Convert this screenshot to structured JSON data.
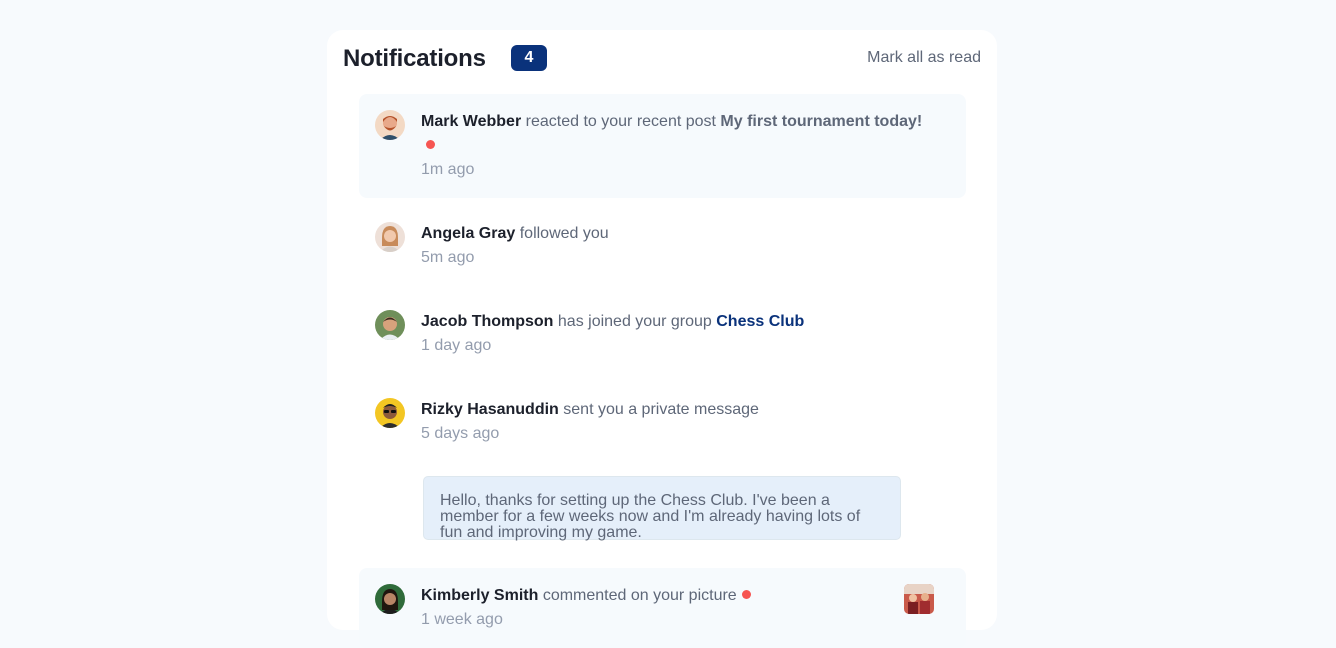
{
  "header": {
    "title": "Notifications",
    "count": "4",
    "mark_all": "Mark all as read"
  },
  "notifications": [
    {
      "name": "Mark Webber",
      "action": "reacted to your recent post",
      "target": "My first tournament today!",
      "time": "1m ago",
      "unread": true
    },
    {
      "name": "Angela Gray",
      "action": "followed you",
      "time": "5m ago",
      "unread": false
    },
    {
      "name": "Jacob Thompson",
      "action": "has joined your group",
      "target": "Chess Club",
      "time": "1 day ago",
      "unread": false
    },
    {
      "name": "Rizky Hasanuddin",
      "action": "sent you a private message",
      "time": "5 days ago",
      "message": "Hello, thanks for setting up the Chess Club. I've been a member for a few weeks now and I'm already having lots of fun and improving my game.",
      "unread": false
    },
    {
      "name": "Kimberly Smith",
      "action": "commented on your picture",
      "time": "1 week ago",
      "unread": true
    }
  ],
  "colors": {
    "accent": "#0a327b",
    "unread_dot": "#f65552",
    "unread_bg": "#f6fafd",
    "message_bg": "#e5effa"
  }
}
